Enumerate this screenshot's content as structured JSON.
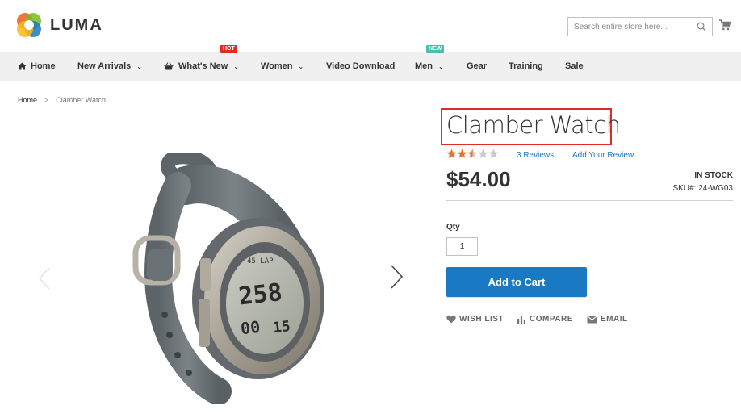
{
  "header": {
    "logo_text": "LUMA",
    "search_placeholder": "Search entire store here...",
    "icons": {
      "search": "search-icon",
      "cart": "cart-icon"
    }
  },
  "nav": {
    "items": [
      {
        "label": "Home",
        "icon": "home-icon"
      },
      {
        "label": "New Arrivals",
        "dropdown": true
      },
      {
        "label": "What's New",
        "icon": "basket-icon",
        "dropdown": true,
        "badge": "HOT"
      },
      {
        "label": "Women",
        "dropdown": true
      },
      {
        "label": "Video Download"
      },
      {
        "label": "Men",
        "dropdown": true,
        "badge": "NEW"
      },
      {
        "label": "Gear"
      },
      {
        "label": "Training"
      },
      {
        "label": "Sale"
      }
    ],
    "badge_colors": {
      "hot": "#e02b27",
      "new": "#44c2b0"
    }
  },
  "breadcrumb": {
    "home": "Home",
    "separator": ">",
    "current": "Clamber Watch"
  },
  "product": {
    "title": "Clamber Watch",
    "rating_stars": 2.5,
    "rating_max": 5,
    "reviews_link": "3 Reviews",
    "add_review_link": "Add Your Review",
    "price": "$54.00",
    "stock_status": "IN STOCK",
    "sku_label": "SKU#:",
    "sku_value": "24-WG03",
    "qty_label": "Qty",
    "qty_value": "1",
    "add_to_cart_label": "Add to Cart",
    "actions": {
      "wishlist": "WISH LIST",
      "compare": "COMPARE",
      "email": "EMAIL"
    },
    "watch_display": {
      "top_label": "45 LAP",
      "main_value": "258",
      "sub_value": "00",
      "secondary_value": "15"
    }
  },
  "colors": {
    "accent": "#1979c3",
    "highlight_border": "#e02b27",
    "star_filled": "#e9722f",
    "star_empty": "#c9c9c9",
    "nav_bg": "#f0f0f0"
  }
}
